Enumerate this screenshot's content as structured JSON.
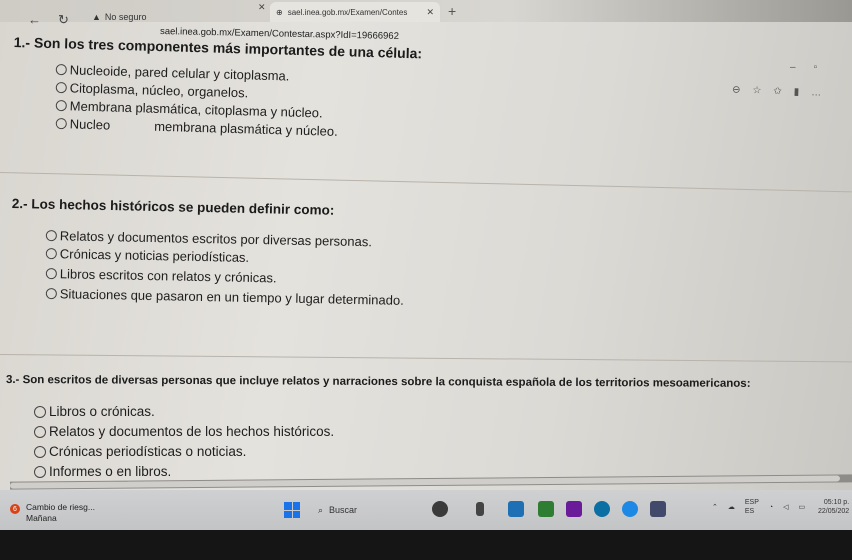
{
  "browser": {
    "tab_title": "sael.inea.gob.mx/Examen/Contes",
    "insecure_label": "No seguro",
    "url": "sael.inea.gob.mx/Examen/Contestar.aspx?IdI=19666962"
  },
  "questions": [
    {
      "title": "1.- Son los tres componentes más importantes de una célula:",
      "options": [
        "Nucleoide, pared celular y citoplasma.",
        "Citoplasma, núcleo, organelos.",
        "Membrana plasmática, citoplasma y núcleo.",
        "Nucleo",
        "membrana plasmática y núcleo."
      ]
    },
    {
      "title": "2.- Los hechos históricos se pueden definir como:",
      "options": [
        "Relatos y documentos escritos por diversas personas.",
        "Crónicas y noticias periodísticas.",
        "Libros escritos con relatos y crónicas.",
        "Situaciones que pasaron en un tiempo y lugar determinado."
      ]
    },
    {
      "title": "3.- Son escritos de diversas personas que incluye relatos y narraciones sobre la conquista española de los territorios mesoamericanos:",
      "options": [
        "Libros o crónicas.",
        "Relatos y documentos de los hechos históricos.",
        "Crónicas periodísticas o noticias.",
        "Informes o en libros."
      ]
    }
  ],
  "taskbar": {
    "weather_badge": "6",
    "weather_title": "Cambio de riesg...",
    "weather_sub": "Mañana",
    "search_label": "Buscar",
    "lang_top": "ESP",
    "lang_bottom": "ES",
    "time": "05:10 p.",
    "date": "22/05/202"
  },
  "colors": {
    "start": "#1a73e8",
    "weather_badge": "#d84315"
  }
}
